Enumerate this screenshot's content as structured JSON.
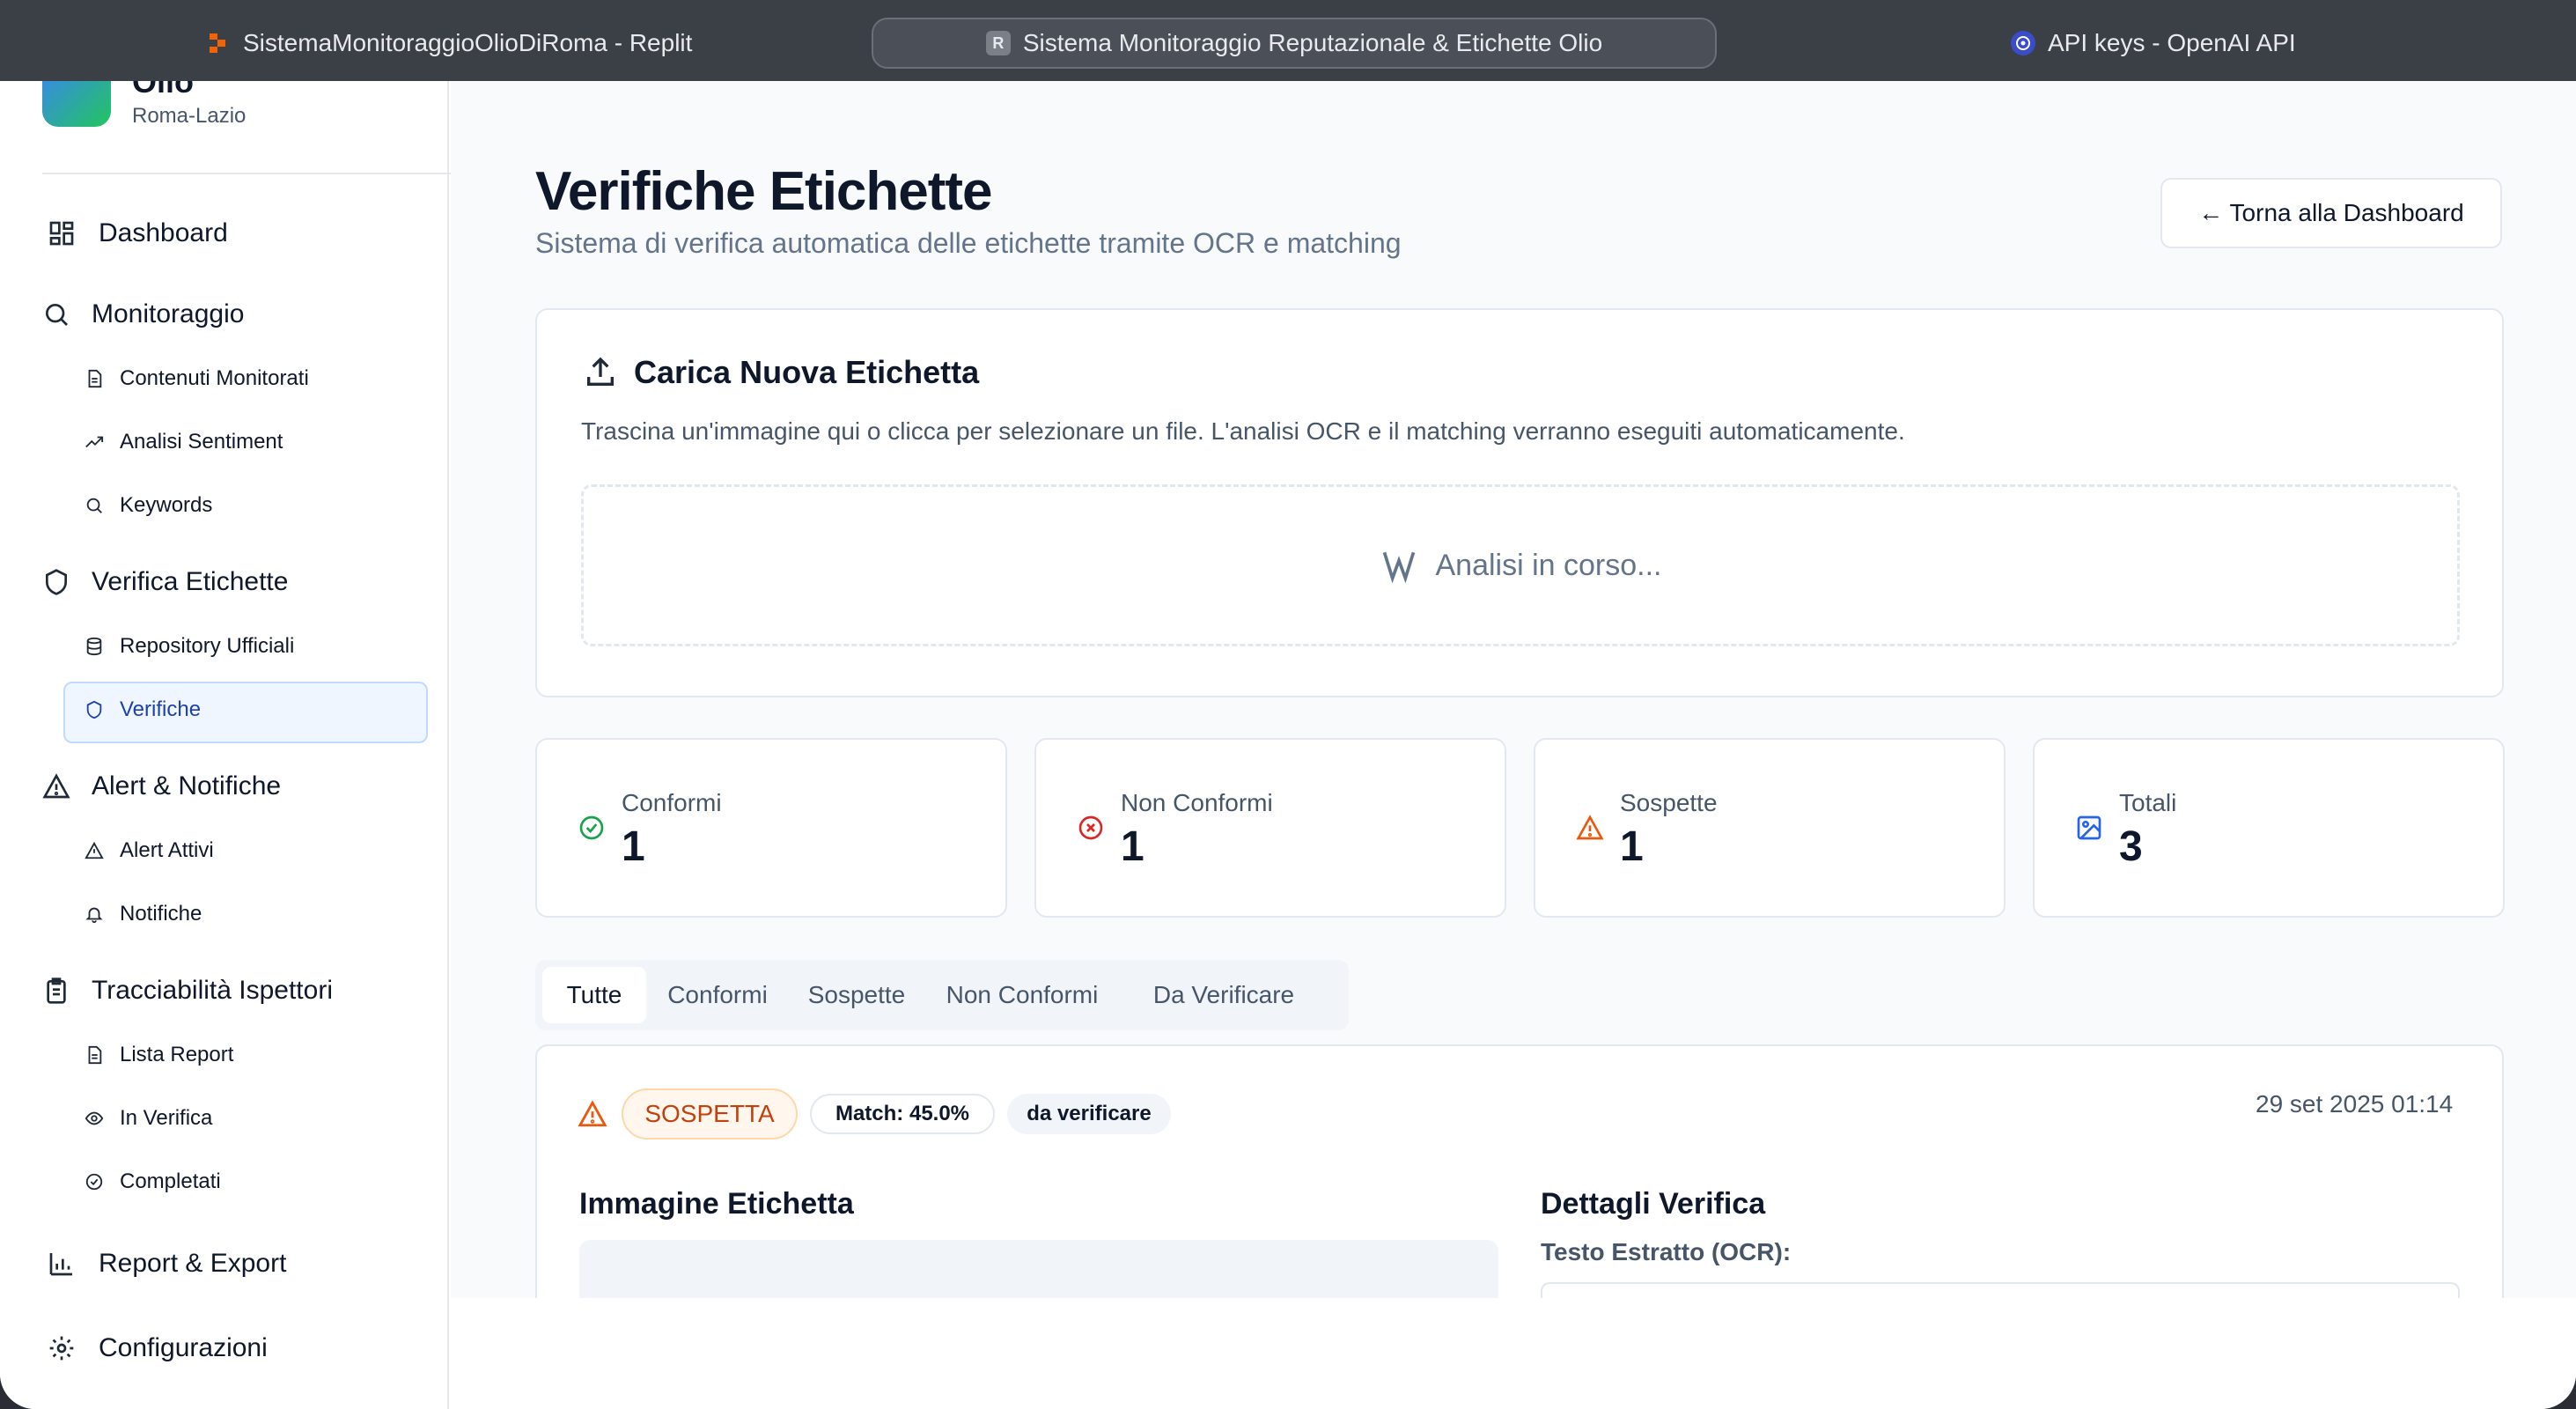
{
  "browser": {
    "tabs": [
      {
        "title": "SistemaMonitoraggioOlioDiRoma - Replit",
        "icon": "replit-icon"
      },
      {
        "title": "Sistema Monitoraggio Reputazionale & Etichette Olio",
        "icon": "R",
        "active": true
      },
      {
        "title": "API keys - OpenAI API",
        "icon": "openai-icon"
      }
    ]
  },
  "sidebar": {
    "brand_title": "Olio",
    "brand_subtitle": "Roma-Lazio",
    "dashboard": "Dashboard",
    "monitoraggio": {
      "label": "Monitoraggio",
      "items": [
        "Contenuti Monitorati",
        "Analisi Sentiment",
        "Keywords"
      ]
    },
    "verifica": {
      "label": "Verifica Etichette",
      "items": [
        "Repository Ufficiali",
        "Verifiche"
      ]
    },
    "alert": {
      "label": "Alert & Notifiche",
      "items": [
        "Alert Attivi",
        "Notifiche"
      ]
    },
    "tracciabilita": {
      "label": "Tracciabilità Ispettori",
      "items": [
        "Lista Report",
        "In Verifica",
        "Completati"
      ]
    },
    "report": "Report & Export",
    "config": "Configurazioni"
  },
  "header": {
    "title": "Verifiche Etichette",
    "subtitle": "Sistema di verifica automatica delle etichette tramite OCR e matching",
    "back_button": "← Torna alla Dashboard"
  },
  "upload": {
    "title": "Carica Nuova Etichetta",
    "description": "Trascina un'immagine qui o clicca per selezionare un file. L'analisi OCR e il matching verranno eseguiti automaticamente.",
    "status": "Analisi in corso..."
  },
  "stats": [
    {
      "label": "Conformi",
      "value": "1",
      "color": "#16a34a",
      "icon": "check-circle-icon"
    },
    {
      "label": "Non Conformi",
      "value": "1",
      "color": "#dc2626",
      "icon": "x-circle-icon"
    },
    {
      "label": "Sospette",
      "value": "1",
      "color": "#ea580c",
      "icon": "warning-icon"
    },
    {
      "label": "Totali",
      "value": "3",
      "color": "#2563eb",
      "icon": "image-icon"
    }
  ],
  "filter_tabs": [
    "Tutte",
    "Conformi",
    "Sospette",
    "Non Conformi",
    "Da Verificare"
  ],
  "result": {
    "status_badge": "SOSPETTA",
    "match_badge": "Match: 45.0%",
    "verify_badge": "da verificare",
    "date": "29 set 2025 01:14",
    "image_heading": "Immagine Etichetta",
    "details_heading": "Dettagli Verifica",
    "ocr_label": "Testo Estratto (OCR):"
  }
}
